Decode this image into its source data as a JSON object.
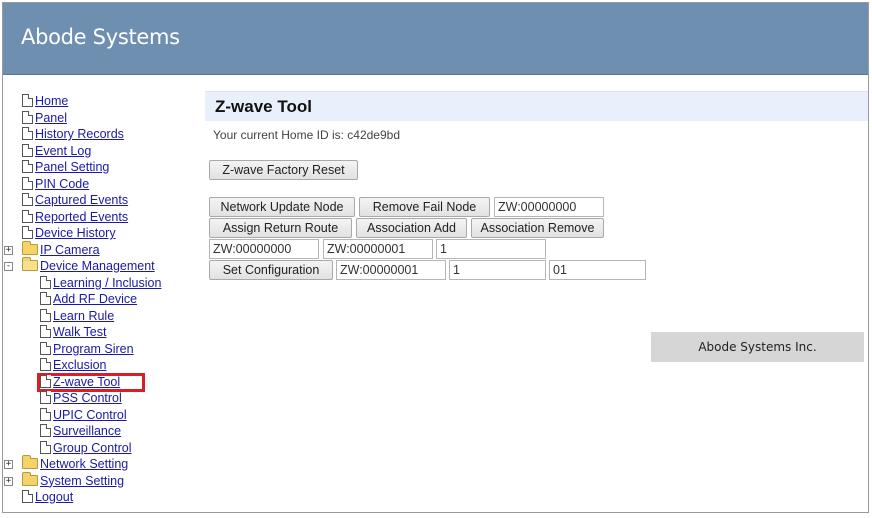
{
  "banner": {
    "title": "Abode Systems"
  },
  "sidebar": {
    "items": [
      {
        "label": "Home",
        "type": "doc",
        "level": 0
      },
      {
        "label": "Panel",
        "type": "doc",
        "level": 0
      },
      {
        "label": "History Records",
        "type": "doc",
        "level": 0
      },
      {
        "label": "Event Log",
        "type": "doc",
        "level": 0
      },
      {
        "label": "Panel Setting",
        "type": "doc",
        "level": 0
      },
      {
        "label": "PIN Code",
        "type": "doc",
        "level": 0
      },
      {
        "label": "Captured Events",
        "type": "doc",
        "level": 0
      },
      {
        "label": "Reported Events",
        "type": "doc",
        "level": 0
      },
      {
        "label": "Device History",
        "type": "doc",
        "level": 0
      },
      {
        "label": "IP Camera",
        "type": "folder",
        "level": 0,
        "expander": "+"
      },
      {
        "label": "Device Management",
        "type": "folder-open",
        "level": 0,
        "expander": "-"
      },
      {
        "label": "Learning / Inclusion",
        "type": "doc",
        "level": 1
      },
      {
        "label": "Add RF Device",
        "type": "doc",
        "level": 1
      },
      {
        "label": "Learn Rule",
        "type": "doc",
        "level": 1
      },
      {
        "label": "Walk Test",
        "type": "doc",
        "level": 1
      },
      {
        "label": "Program Siren",
        "type": "doc",
        "level": 1
      },
      {
        "label": "Exclusion",
        "type": "doc",
        "level": 1
      },
      {
        "label": "Z-wave Tool",
        "type": "doc",
        "level": 1,
        "selected": true
      },
      {
        "label": "PSS Control",
        "type": "doc",
        "level": 1
      },
      {
        "label": "UPIC Control",
        "type": "doc",
        "level": 1
      },
      {
        "label": "Surveillance",
        "type": "doc",
        "level": 1
      },
      {
        "label": "Group Control",
        "type": "doc",
        "level": 1
      },
      {
        "label": "Network Setting",
        "type": "folder",
        "level": 0,
        "expander": "+"
      },
      {
        "label": "System Setting",
        "type": "folder",
        "level": 0,
        "expander": "+"
      },
      {
        "label": "Logout",
        "type": "doc",
        "level": 0
      }
    ]
  },
  "main": {
    "title": "Z-wave Tool",
    "home_id_text": "Your current Home ID is: c42de9bd",
    "factory_reset_label": "Z-wave Factory Reset",
    "row1": {
      "network_update_label": "Network Update Node",
      "remove_fail_label": "Remove Fail Node",
      "node_field_value": "ZW:00000000"
    },
    "row2": {
      "assign_return_label": "Assign Return Route",
      "association_add_label": "Association Add",
      "association_remove_label": "Association Remove"
    },
    "row3": {
      "field1_value": "ZW:00000000",
      "field2_value": "ZW:00000001",
      "field3_value": "1"
    },
    "row4": {
      "set_config_label": "Set Configuration",
      "field1_value": "ZW:00000001",
      "field2_value": "1",
      "field3_value": "01"
    }
  },
  "footer": {
    "text": "Abode Systems Inc."
  },
  "colors": {
    "banner": "#6f8fb0",
    "title_bar": "#e9f0fb",
    "link": "#1a1aa6",
    "selection_box": "#d91f26"
  }
}
